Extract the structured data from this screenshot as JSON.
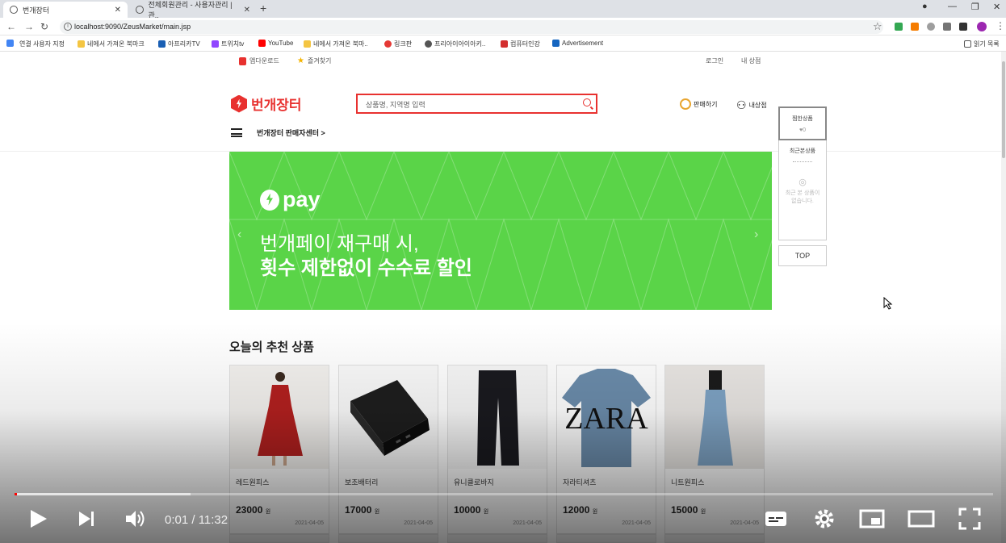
{
  "browser": {
    "tabs": [
      {
        "label": "번개장터",
        "active": true
      },
      {
        "label": "전체회원관리 - 사용자관리 | 관..",
        "active": false
      }
    ],
    "url": "localhost:9090/ZeusMarket/main.jsp",
    "bookmarks": [
      {
        "label": "앱",
        "color": "#4285f4"
      },
      {
        "label": "연결 사용자 지정",
        "color": "#ffffff"
      },
      {
        "label": "네에서 가져온 북마크",
        "color": "#f4c542"
      },
      {
        "label": "아프리카TV",
        "color": "#1a5fb4"
      },
      {
        "label": "트위치tv",
        "color": "#9146ff"
      },
      {
        "label": "YouTube",
        "color": "#ff0000"
      },
      {
        "label": "네에서 가져온 북마..",
        "color": "#f4c542"
      },
      {
        "label": "링크판",
        "color": "#e53935"
      },
      {
        "label": "프리아이아이아키..",
        "color": "#555555"
      },
      {
        "label": "컴퓨터인강",
        "color": "#d32f2f"
      },
      {
        "label": "Advertisement",
        "color": "#1565c0"
      }
    ],
    "reading_list": "읽기 목록"
  },
  "page": {
    "top_links": {
      "app_download": "앱다운로드",
      "favorite": "즐겨찾기",
      "login": "로그인",
      "my_shop": "내 상점"
    },
    "logo": "번개장터",
    "search_placeholder": "상품명, 지역명 입력",
    "sell_label": "판매하기",
    "my_shop_label": "내상점",
    "seller_center": "번개장터 판매자센터 >",
    "banner": {
      "brand": "pay",
      "line1": "번개페이 재구매 시,",
      "line2": "횟수 제한없이 수수료 할인",
      "bg_color": "#5ad448"
    },
    "quick_menu": {
      "liked": "찜한상품",
      "liked_count": "♥0",
      "recent": "최근본상품",
      "recent_empty": "최근 본 상품이 없습니다.",
      "top": "TOP"
    },
    "section_title": "오늘의 추천 상품",
    "products": [
      {
        "name": "레드원피스",
        "price": "23000",
        "unit": "원",
        "date": "2021-04-05"
      },
      {
        "name": "보조배터리",
        "price": "17000",
        "unit": "원",
        "date": "2021-04-05"
      },
      {
        "name": "유니클로바지",
        "price": "10000",
        "unit": "원",
        "date": "2021-04-05"
      },
      {
        "name": "자라티셔츠",
        "price": "12000",
        "unit": "원",
        "date": "2021-04-05"
      },
      {
        "name": "니트원피스",
        "price": "15000",
        "unit": "원",
        "date": "2021-04-05"
      }
    ],
    "zara_text": "ZARA"
  },
  "player": {
    "time": "0:01 / 11:32",
    "progress_played_fraction": 0.001,
    "progress_buffered_fraction": 0.18
  }
}
